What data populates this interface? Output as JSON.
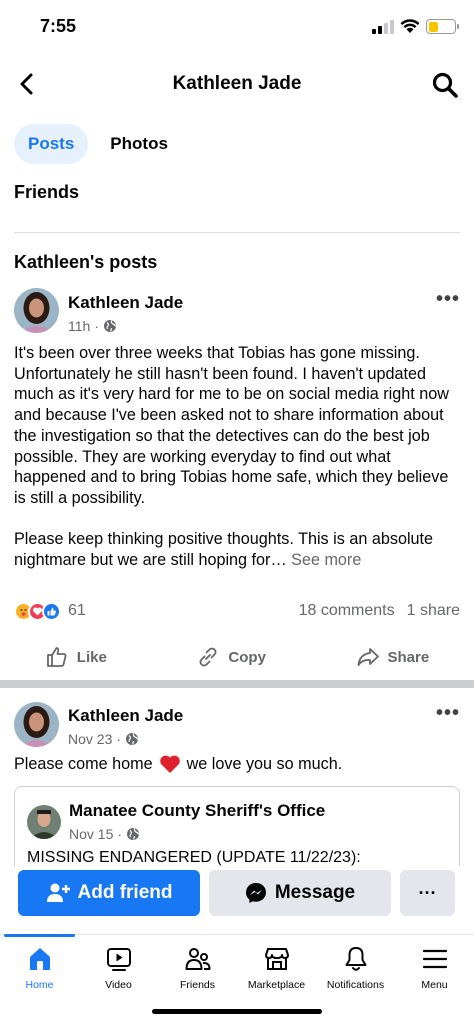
{
  "status_bar": {
    "time": "7:55"
  },
  "header": {
    "title": "Kathleen Jade"
  },
  "tabs": [
    {
      "label": "Posts"
    },
    {
      "label": "Photos"
    }
  ],
  "friends_tab": "Friends",
  "section_title": "Kathleen's posts",
  "post1": {
    "author": "Kathleen Jade",
    "time": "11h",
    "text": "It's been over three weeks that Tobias has gone missing. Unfortunately he still hasn't been found. I haven't updated much as it's very hard for me to be on social media right now and because I've been asked not to share information about the investigation so that the detectives can do the best job possible. They are working everyday to find out what happened and to bring Tobias home safe, which they believe is still a possibility.\n\nPlease keep thinking positive thoughts. This is an absolute nightmare but we are still hoping for…",
    "see_more": "See more",
    "reaction_count": "61",
    "comments": "18 comments",
    "shares": "1 share",
    "actions": {
      "like": "Like",
      "copy": "Copy",
      "share": "Share"
    }
  },
  "post2": {
    "author": "Kathleen Jade",
    "time": "Nov 23",
    "text_before": "Please come home",
    "text_after": "we love you so much.",
    "shared": {
      "author": "Manatee County Sheriff's Office",
      "time": "Nov 15",
      "text": "MISSING ENDANGERED (UPDATE 11/22/23):"
    }
  },
  "cta": {
    "add_friend": "Add friend",
    "message": "Message",
    "more": "···"
  },
  "bottom_nav": [
    {
      "label": "Home",
      "icon": "home-icon"
    },
    {
      "label": "Video",
      "icon": "video-icon"
    },
    {
      "label": "Friends",
      "icon": "friends-icon"
    },
    {
      "label": "Marketplace",
      "icon": "marketplace-icon"
    },
    {
      "label": "Notifications",
      "icon": "bell-icon"
    },
    {
      "label": "Menu",
      "icon": "menu-icon"
    }
  ],
  "colors": {
    "accent": "#1877f2",
    "text_secondary": "#65676b",
    "battery": "#f7c600"
  }
}
